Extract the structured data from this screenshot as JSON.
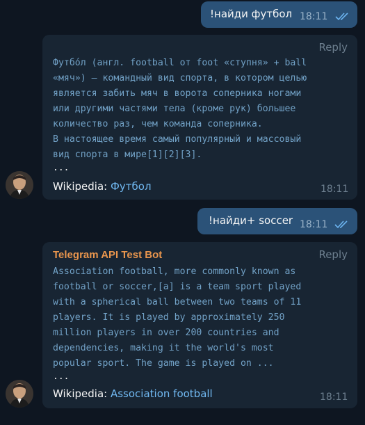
{
  "messages": [
    {
      "text": "!найди футбол",
      "time": "18:11"
    },
    {
      "reply_label": "Reply",
      "lines": [
        "Футбо́л (англ. football от foot «ступня» + ball",
        "«мяч») — командный вид спорта, в котором целью",
        "является забить мяч в ворота соперника ногами",
        "или другими частями тела (кроме рук) большее",
        "количество раз, чем команда соперника.",
        "В настоящее время самый популярный и массовый",
        "вид спорта в мире[1][2][3]."
      ],
      "ellipsis": "...",
      "source_prefix": "Wikipedia: ",
      "source_link": "Футбол",
      "time": "18:11"
    },
    {
      "text": "!найди+ soccer",
      "time": "18:11"
    },
    {
      "sender": "Telegram API Test Bot",
      "reply_label": "Reply",
      "lines": [
        "Association football, more commonly known as",
        "football or soccer,[a] is a team sport played",
        "with a spherical ball between two teams of 11",
        "players. It is played by approximately 250",
        "million players in over 200 countries and",
        "dependencies, making it the world's most",
        "popular sport. The game is played on ..."
      ],
      "ellipsis": "...",
      "source_prefix": "Wikipedia: ",
      "source_link": "Association football",
      "time": "18:11"
    }
  ],
  "colors": {
    "background": "#0e1621",
    "outgoing": "#2b5278",
    "incoming": "#182533",
    "link": "#71b9f2",
    "sender": "#e8954d",
    "code": "#72a2c7"
  }
}
